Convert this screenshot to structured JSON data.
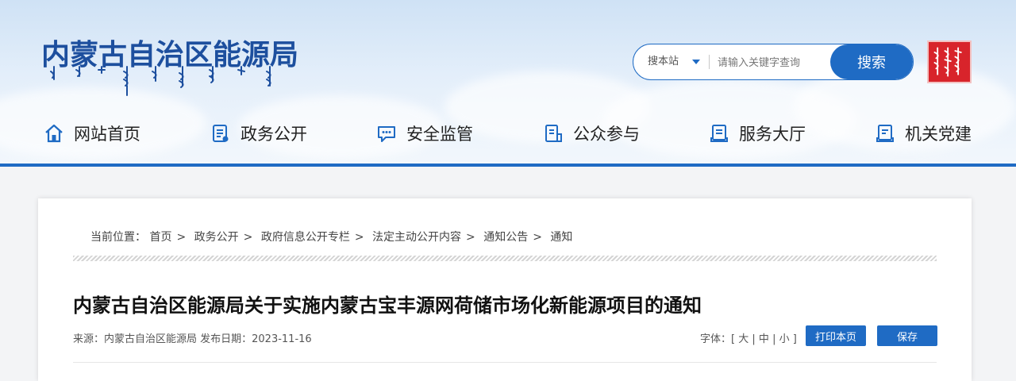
{
  "site": {
    "title": "内蒙古自治区能源局"
  },
  "search": {
    "scope_label": "搜本站",
    "placeholder": "请输入关键字查询",
    "button_label": "搜索"
  },
  "nav": {
    "items": [
      {
        "label": "网站首页",
        "icon": "home-icon"
      },
      {
        "label": "政务公开",
        "icon": "document-list-icon"
      },
      {
        "label": "安全监管",
        "icon": "message-icon"
      },
      {
        "label": "公众参与",
        "icon": "clipboard-icon"
      },
      {
        "label": "服务大厅",
        "icon": "service-book-icon"
      },
      {
        "label": "机关党建",
        "icon": "party-book-icon"
      }
    ]
  },
  "breadcrumb": {
    "prefix": "当前位置：",
    "items": [
      "首页",
      "政务公开",
      "政府信息公开专栏",
      "法定主动公开内容",
      "通知公告",
      "通知"
    ],
    "separator": ">"
  },
  "article": {
    "title": "内蒙古自治区能源局关于实施内蒙古宝丰源网荷储市场化新能源项目的通知",
    "source": "来源：内蒙古自治区能源局 发布日期：2023-11-16",
    "font_label": "字体：",
    "font_open": "[",
    "font_sizes": [
      "大",
      "中",
      "小"
    ],
    "font_sep": "|",
    "font_close": "]",
    "print_label": "打印本页",
    "save_label": "保存"
  },
  "colors": {
    "brand_blue": "#1f6bc4",
    "title_blue": "#1d4f9e",
    "seal_red": "#d8242b"
  }
}
